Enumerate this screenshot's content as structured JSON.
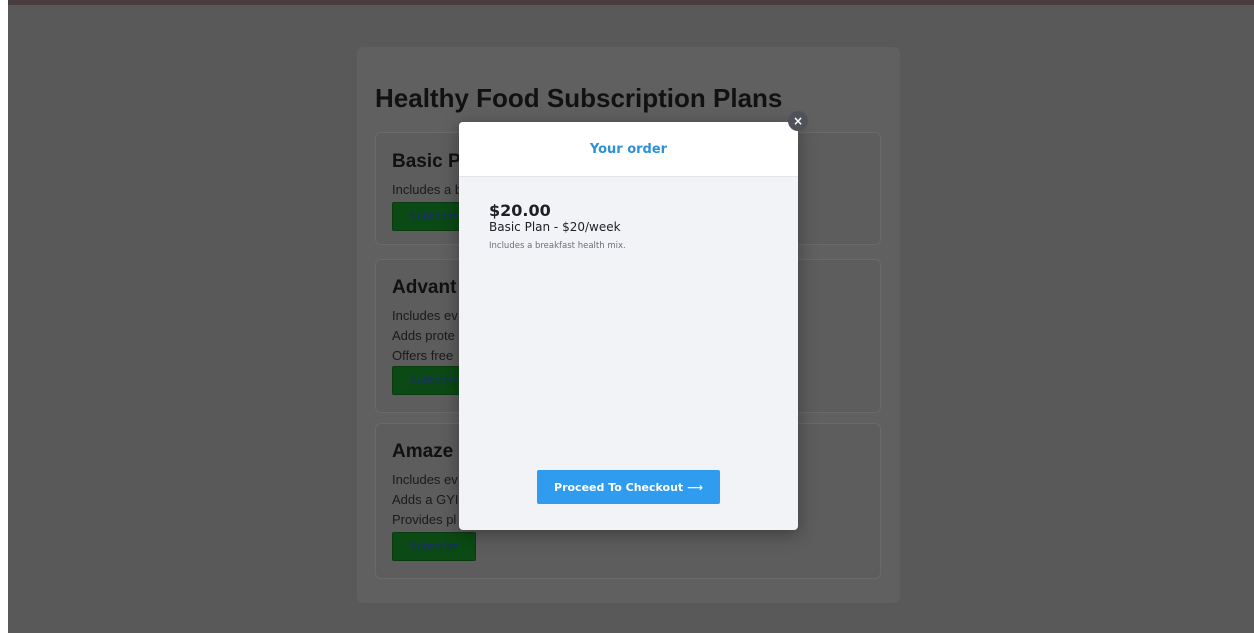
{
  "page": {
    "title": "Healthy Food Subscription Plans",
    "plans": [
      {
        "title": "Basic P",
        "lines": [
          "Includes a b"
        ],
        "button": "Subscribe"
      },
      {
        "title": "Advant",
        "lines": [
          "Includes ev",
          "Adds prote",
          "Offers free"
        ],
        "button": "Subscribe"
      },
      {
        "title": "Amaze",
        "lines": [
          "Includes ev",
          "Adds a GYI",
          "Provides pl"
        ],
        "button": "Subscribe"
      }
    ]
  },
  "modal": {
    "title": "Your order",
    "close_label": "×",
    "order": {
      "price": "$20.00",
      "name": "Basic Plan - $20/week",
      "description": "Includes a breakfast health mix."
    },
    "checkout_label": "Proceed To Checkout",
    "checkout_arrow": "⟶"
  },
  "colors": {
    "overlay": "#595959",
    "accent": "#2f9cf0",
    "modal_title": "#2c91d6",
    "subscribe_button": "#0b4a14"
  }
}
